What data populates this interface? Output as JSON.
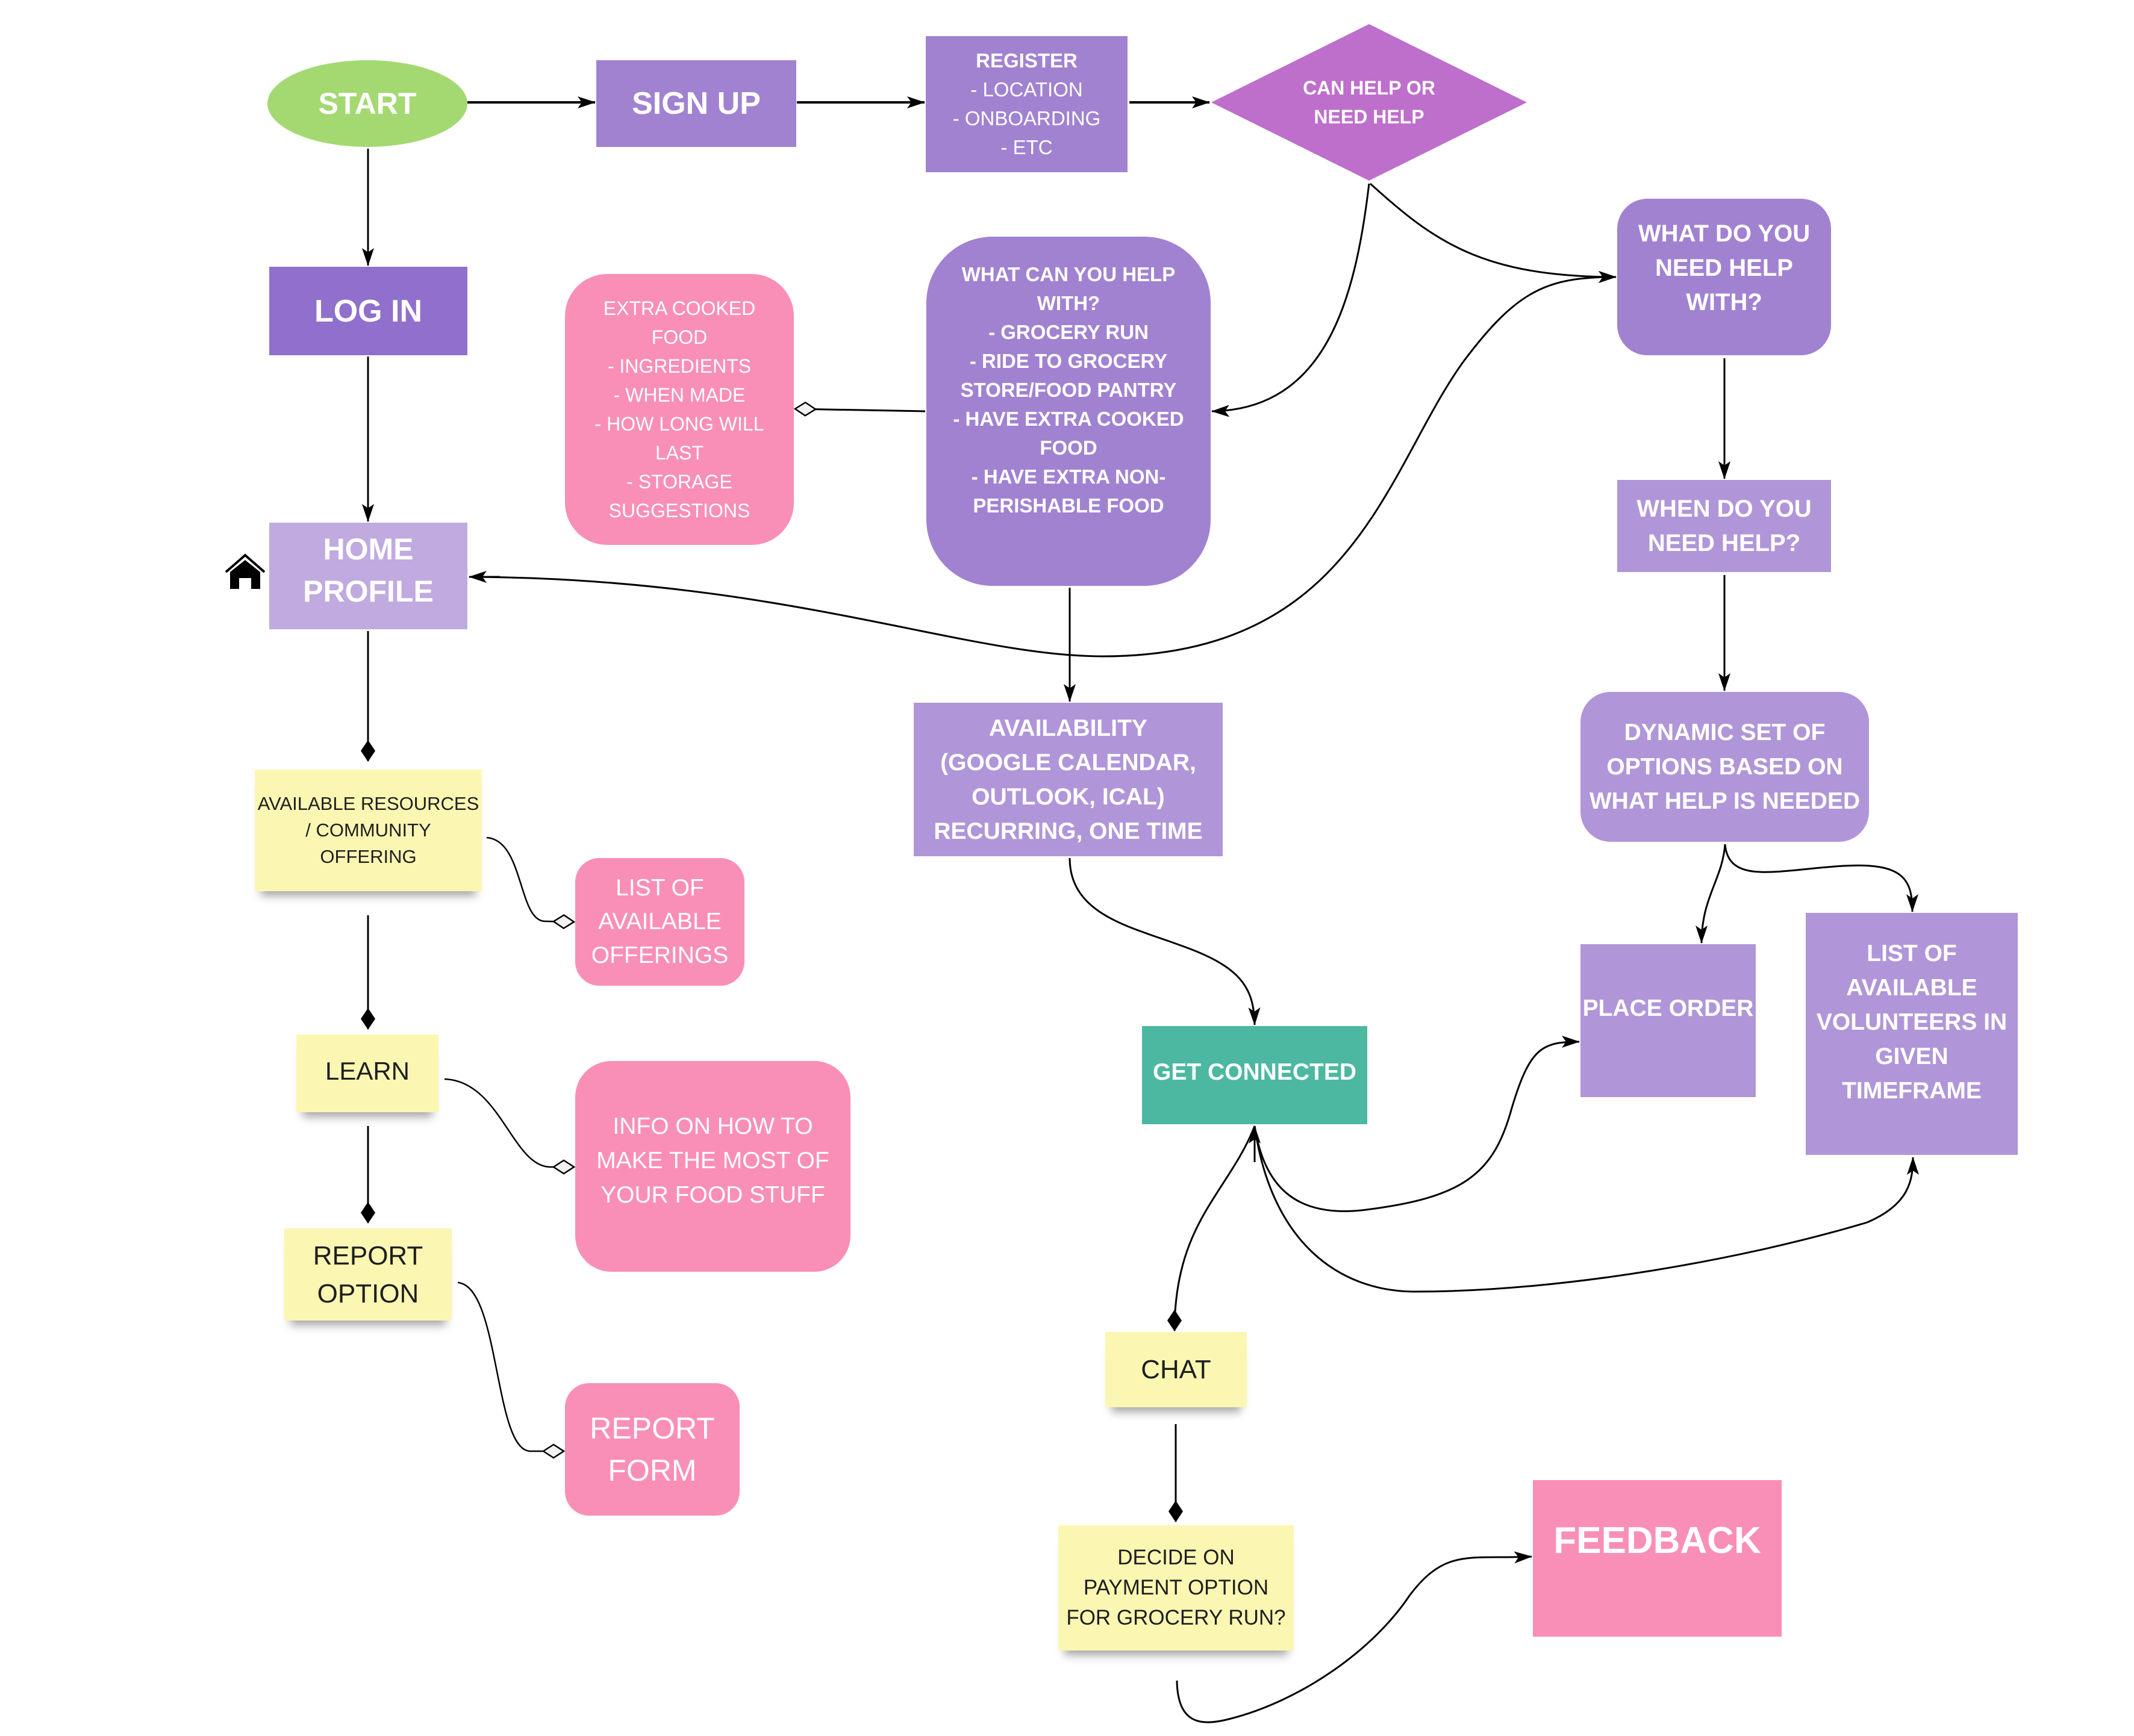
{
  "colors": {
    "start": "#a4d972",
    "primary_purple": "#a182d1",
    "dark_purple": "#9070cc",
    "diamond_purple": "#bd6fcb",
    "pink": "#f98fb6",
    "teal": "#4db8a1",
    "sticky_yellow": "#fbf7b2",
    "edge": "#000000"
  },
  "nodes": {
    "start": "START",
    "sign_up": "SIGN UP",
    "register": {
      "title": "REGISTER",
      "items": [
        "- LOCATION",
        "- ONBOARDING",
        "- ETC"
      ]
    },
    "decision": "CAN HELP OR\nNEED HELP",
    "log_in": "LOG IN",
    "extra_cooked_food": "EXTRA COOKED\nFOOD\n- INGREDIENTS\n- WHEN MADE\n- HOW LONG WILL\nLAST\n- STORAGE\nSUGGESTIONS",
    "what_can_you_help": "WHAT CAN YOU HELP\nWITH?\n- GROCERY RUN\n- RIDE TO GROCERY\nSTORE/FOOD PANTRY\n- HAVE EXTRA COOKED\nFOOD\n- HAVE EXTRA NON-\nPERISHABLE FOOD",
    "what_do_you_need": "WHAT DO YOU\nNEED HELP\nWITH?",
    "home_profile": "HOME\nPROFILE",
    "when_do_you_need": "WHEN DO YOU\nNEED HELP?",
    "availability": "AVAILABILITY\n(GOOGLE CALENDAR,\nOUTLOOK, ICAL)\nRECURRING, ONE TIME",
    "dynamic_set": "DYNAMIC SET OF\nOPTIONS BASED ON\nWHAT HELP IS NEEDED",
    "available_resources": "AVAILABLE RESOURCES\n/ COMMUNITY\nOFFERING",
    "list_of_offerings": "LIST OF\nAVAILABLE\nOFFERINGS",
    "place_order": "PLACE ORDER",
    "list_of_volunteers": "LIST OF\nAVAILABLE\nVOLUNTEERS IN\nGIVEN\nTIMEFRAME",
    "get_connected": "GET CONNECTED",
    "learn": "LEARN",
    "info_how_to": "INFO ON HOW TO\nMAKE THE MOST OF\nYOUR FOOD STUFF",
    "report_option": "REPORT\nOPTION",
    "report_form": "REPORT\nFORM",
    "chat": "CHAT",
    "decide_payment": "DECIDE ON\nPAYMENT OPTION\nFOR GROCERY RUN?",
    "feedback": "FEEDBACK"
  },
  "icons": {
    "home": "home-icon"
  },
  "edges": [
    {
      "from": "start",
      "to": "sign_up",
      "type": "arrow"
    },
    {
      "from": "sign_up",
      "to": "register",
      "type": "arrow"
    },
    {
      "from": "register",
      "to": "decision",
      "type": "arrow"
    },
    {
      "from": "start",
      "to": "log_in",
      "type": "arrow"
    },
    {
      "from": "log_in",
      "to": "home_profile",
      "type": "arrow"
    },
    {
      "from": "decision",
      "to": "what_can_you_help",
      "type": "arrow"
    },
    {
      "from": "decision",
      "to": "what_do_you_need",
      "type": "arrow"
    },
    {
      "from": "what_can_you_help",
      "to": "extra_cooked_food",
      "type": "open-diamond"
    },
    {
      "from": "what_can_you_help",
      "to": "availability",
      "type": "arrow"
    },
    {
      "from": "home_profile",
      "to": "what_do_you_need",
      "type": "double-arrow"
    },
    {
      "from": "what_do_you_need",
      "to": "when_do_you_need",
      "type": "arrow"
    },
    {
      "from": "when_do_you_need",
      "to": "dynamic_set",
      "type": "arrow"
    },
    {
      "from": "dynamic_set",
      "to": "place_order",
      "type": "arrow"
    },
    {
      "from": "dynamic_set",
      "to": "list_of_volunteers",
      "type": "arrow"
    },
    {
      "from": "availability",
      "to": "get_connected",
      "type": "arrow"
    },
    {
      "from": "get_connected",
      "to": "place_order",
      "type": "double-arrow"
    },
    {
      "from": "get_connected",
      "to": "list_of_volunteers",
      "type": "double-arrow"
    },
    {
      "from": "get_connected",
      "to": "chat",
      "type": "filled-diamond"
    },
    {
      "from": "home_profile",
      "to": "available_resources",
      "type": "filled-diamond"
    },
    {
      "from": "available_resources",
      "to": "list_of_offerings",
      "type": "open-diamond"
    },
    {
      "from": "available_resources",
      "to": "learn",
      "type": "filled-diamond"
    },
    {
      "from": "learn",
      "to": "info_how_to",
      "type": "open-diamond"
    },
    {
      "from": "learn",
      "to": "report_option",
      "type": "filled-diamond"
    },
    {
      "from": "report_option",
      "to": "report_form",
      "type": "open-diamond"
    },
    {
      "from": "chat",
      "to": "decide_payment",
      "type": "filled-diamond"
    },
    {
      "from": "decide_payment",
      "to": "feedback",
      "type": "arrow"
    }
  ]
}
